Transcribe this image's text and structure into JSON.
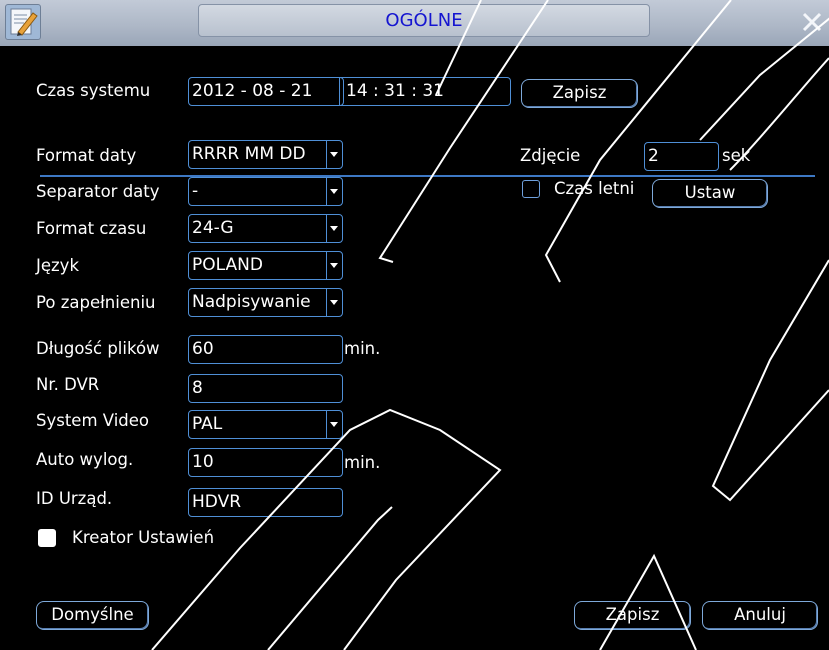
{
  "window": {
    "title": "OGÓLNE",
    "app_icon": "edit-note-icon",
    "close_icon": "close-icon",
    "accent": "#4f8fd6",
    "title_color": "#1515d0",
    "background": "#000000"
  },
  "system_time": {
    "label": "Czas systemu",
    "date": "2012  -  08  -  21",
    "time": "14  :  31  :  31",
    "save_label": "Zapisz"
  },
  "fields": {
    "date_format": {
      "label": "Format daty",
      "value": "RRRR MM DD"
    },
    "date_separator": {
      "label": "Separator daty",
      "value": "-"
    },
    "time_format": {
      "label": "Format czasu",
      "value": "24-G"
    },
    "language": {
      "label": "Język",
      "value": "POLAND"
    },
    "hdd_full": {
      "label": "Po zapełnieniu",
      "value": "Nadpisywanie"
    },
    "file_length": {
      "label": "Długość plików",
      "value": "60",
      "unit": "min."
    },
    "dvr_no": {
      "label": "Nr. DVR",
      "value": "8"
    },
    "video_system": {
      "label": "System Video",
      "value": "PAL"
    },
    "auto_logout": {
      "label": "Auto wylog.",
      "value": "10",
      "unit": "min."
    },
    "device_id": {
      "label": "ID Urząd.",
      "value": "HDVR"
    }
  },
  "snapshot": {
    "label": "Zdjęcie",
    "value": "2",
    "unit": "sek"
  },
  "dst": {
    "label": "Czas letni",
    "checked": false,
    "button_label": "Ustaw"
  },
  "wizard": {
    "label": "Kreator Ustawień",
    "checked": true
  },
  "footer": {
    "default_label": "Domyślne",
    "save_label": "Zapisz",
    "cancel_label": "Anuluj"
  }
}
